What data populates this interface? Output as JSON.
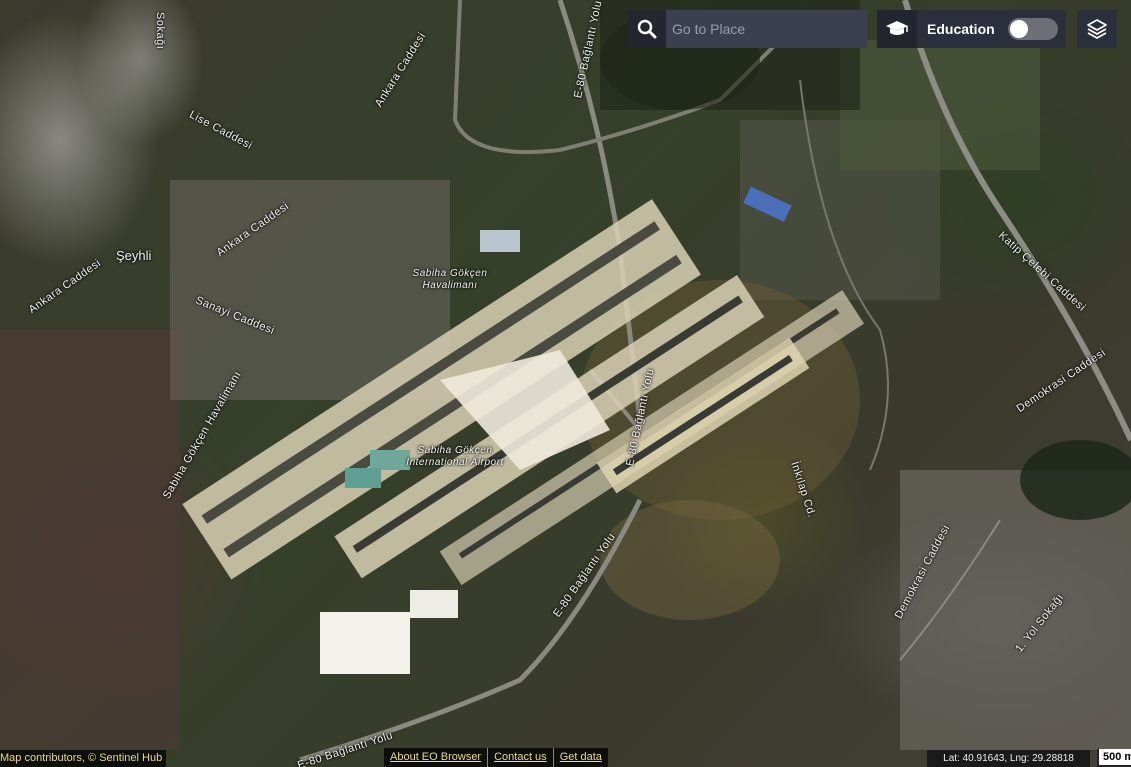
{
  "map": {
    "labels": {
      "seyhli": "Şeyhli",
      "lise_caddesi": "Lise Caddesi",
      "ankara_caddesi_1": "Ankara Caddesi",
      "ankara_caddesi_2": "Ankara Caddesi",
      "ankara_caddesi_3": "Ankara Caddesi",
      "sanayi_caddesi": "Sanayi Caddesi",
      "sokagi_top": "Sokağı",
      "sabiha_gokcen_havalimani_road": "Sabiha Gökçen Havalimanı",
      "airport_tr": "Sabiha Gökçen Havalimanı",
      "airport_en": "Sabiha Gökçen International Airport",
      "e80_1": "E-80 Bağlantı Yolu",
      "e80_2": "E-80 Bağlantı Yolu",
      "e80_3": "E-80 Bağlantı Yolu",
      "e80_4": "E-80 Bağlantı Yolu",
      "e80_5": "E-80 Bağlantı Yolu",
      "inkilap_cd": "İnkılap Cd.",
      "katip_celebi": "Katip Çelebi Caddesi",
      "demokrasi_1": "Demokrasi Caddesi",
      "demokrasi_2": "Demokrasi Caddesi",
      "yol_sokagi": "1. Yol Sokağı"
    }
  },
  "toolbar": {
    "search_placeholder": "Go to Place",
    "education_label": "Education",
    "education_enabled": false,
    "icons": {
      "search": "search-icon",
      "education": "graduation-cap-icon",
      "layers": "layers-icon"
    }
  },
  "footer": {
    "attribution": "Map contributors, © Sentinel Hub",
    "links": [
      "About EO Browser",
      "Contact us",
      "Get data"
    ],
    "coordinates": "Lat: 40.91643, Lng: 29.28818",
    "scale": "500 m"
  }
}
